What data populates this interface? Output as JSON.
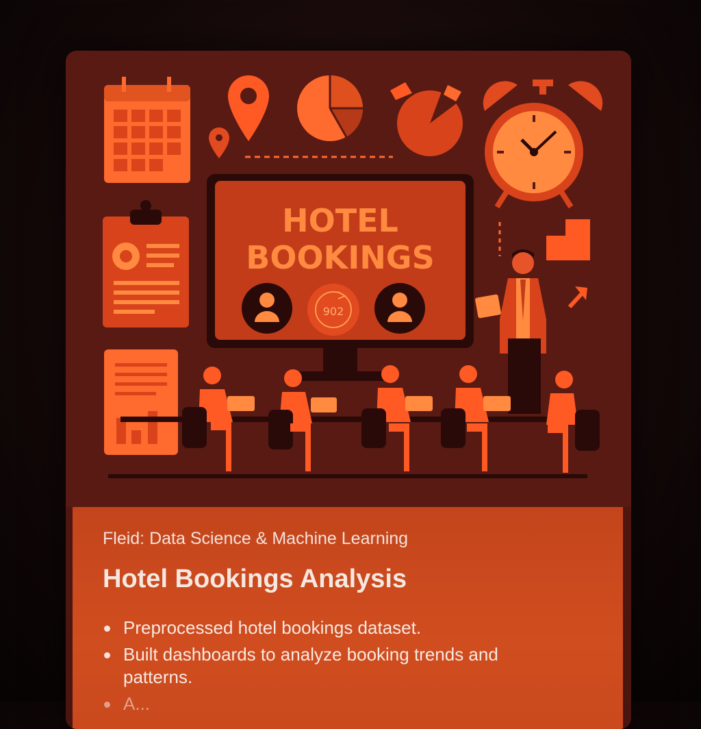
{
  "illustration": {
    "screen_title_line1": "HOTEL",
    "screen_title_line2": "BOOKINGS",
    "badge_text": "902"
  },
  "project": {
    "field": "Fleid: Data Science & Machine Learning",
    "title": "Hotel Bookings Analysis",
    "bullets": [
      "Preprocessed hotel bookings dataset.",
      "Built dashboards to analyze booking trends and patterns.",
      "A..."
    ]
  },
  "colors": {
    "accent": "#ff6a2e",
    "panel": "#d04d1f",
    "illustration_bg": "#5a1a14"
  }
}
